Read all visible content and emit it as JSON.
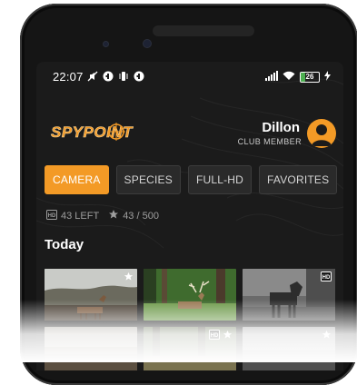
{
  "status_bar": {
    "time": "22:07",
    "battery_level": "26",
    "icons": [
      "mute-icon",
      "app-icon",
      "vibrate-icon",
      "app-icon",
      "signal-icon",
      "wifi-icon",
      "battery-icon",
      "charging-icon"
    ]
  },
  "header": {
    "logo_text": "SPYPOINT",
    "user_name": "Dillon",
    "user_role": "CLUB MEMBER"
  },
  "tabs": [
    {
      "label": "CAMERA",
      "active": true
    },
    {
      "label": "SPECIES",
      "active": false
    },
    {
      "label": "FULL-HD",
      "active": false
    },
    {
      "label": "FAVORITES",
      "active": false
    }
  ],
  "quota": {
    "hd_left": "43 LEFT",
    "favorites": "43 / 500"
  },
  "section": {
    "title": "Today"
  },
  "photos": [
    {
      "subject": "deer",
      "scene": "color-dusk",
      "badges": [
        "star-icon"
      ]
    },
    {
      "subject": "buck",
      "scene": "color-forest",
      "badges": []
    },
    {
      "subject": "moose",
      "scene": "night-grayscale",
      "badges": [
        "hd-icon"
      ]
    },
    {
      "subject": "unknown",
      "scene": "color",
      "badges": []
    },
    {
      "subject": "unknown",
      "scene": "color",
      "badges": [
        "hd-icon",
        "star-icon"
      ]
    },
    {
      "subject": "unknown",
      "scene": "grayscale",
      "badges": [
        "star-icon"
      ]
    }
  ],
  "colors": {
    "accent": "#f39a26",
    "background": "#1b1b1b",
    "tab_bg": "#2a2a2a"
  }
}
